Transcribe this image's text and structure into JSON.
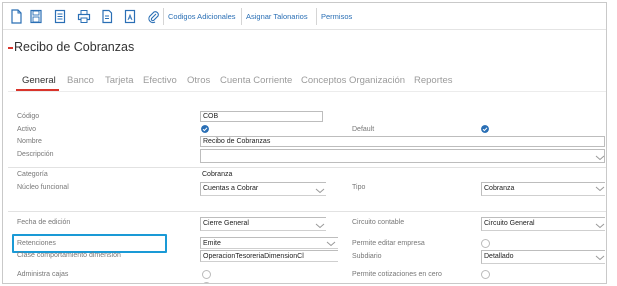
{
  "toolbar": {
    "icons": [
      "new-document-icon",
      "save-icon",
      "document-list-icon",
      "print-icon",
      "document-icon",
      "export-icon",
      "attach-icon"
    ],
    "links": [
      "Codigos Adicionales",
      "Asignar Talonarios",
      "Permisos"
    ]
  },
  "page": {
    "title": "Recibo de Cobranzas"
  },
  "tabs": [
    "General",
    "Banco",
    "Tarjeta",
    "Efectivo",
    "Otros",
    "Cuenta Corriente",
    "Conceptos Organización",
    "Reportes"
  ],
  "form": {
    "codigo_label": "Código",
    "codigo_value": "COB",
    "activo_label": "Activo",
    "default_label": "Default",
    "nombre_label": "Nombre",
    "nombre_value": "Recibo de Cobranzas",
    "descripcion_label": "Descripción",
    "descripcion_value": "",
    "categoria_label": "Categoría",
    "categoria_value": "Cobranza",
    "nucleo_label": "Núcleo funcional",
    "nucleo_value": "Cuentas a Cobrar",
    "tipo_label": "Tipo",
    "tipo_value": "Cobranza",
    "fecha_label": "Fecha de edición",
    "fecha_value": "Cierre General",
    "circuito_label": "Circuito contable",
    "circuito_value": "Circuito General",
    "retenciones_label": "Retenciones",
    "retenciones_value": "Emite",
    "permite_editar_label": "Permite editar empresa",
    "clase_label": "Clase comportamiento dimensión",
    "clase_value": "OperacionTesoreriaDimensionCl",
    "subdiario_label": "Subdiario",
    "subdiario_value": "Detallado",
    "administra_label": "Administra cajas",
    "permite_cotizaciones_label": "Permite cotizaciones en cero"
  },
  "colors": {
    "accent": "#2a6fb5",
    "tab_active": "#d9342b",
    "highlight": "#1a9ad6"
  }
}
